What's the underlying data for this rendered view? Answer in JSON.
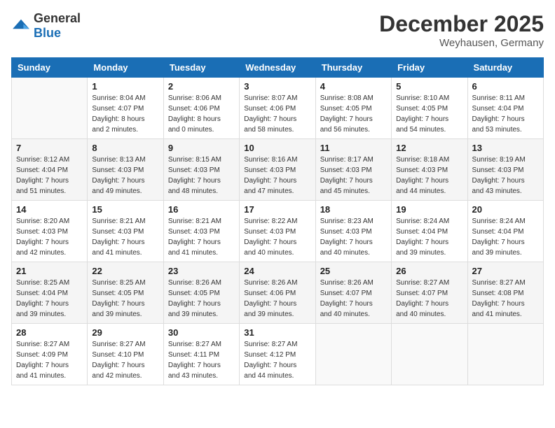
{
  "header": {
    "logo_general": "General",
    "logo_blue": "Blue",
    "title": "December 2025",
    "subtitle": "Weyhausen, Germany"
  },
  "calendar": {
    "days_of_week": [
      "Sunday",
      "Monday",
      "Tuesday",
      "Wednesday",
      "Thursday",
      "Friday",
      "Saturday"
    ],
    "weeks": [
      [
        {
          "day": "",
          "info": ""
        },
        {
          "day": "1",
          "info": "Sunrise: 8:04 AM\nSunset: 4:07 PM\nDaylight: 8 hours\nand 2 minutes."
        },
        {
          "day": "2",
          "info": "Sunrise: 8:06 AM\nSunset: 4:06 PM\nDaylight: 8 hours\nand 0 minutes."
        },
        {
          "day": "3",
          "info": "Sunrise: 8:07 AM\nSunset: 4:06 PM\nDaylight: 7 hours\nand 58 minutes."
        },
        {
          "day": "4",
          "info": "Sunrise: 8:08 AM\nSunset: 4:05 PM\nDaylight: 7 hours\nand 56 minutes."
        },
        {
          "day": "5",
          "info": "Sunrise: 8:10 AM\nSunset: 4:05 PM\nDaylight: 7 hours\nand 54 minutes."
        },
        {
          "day": "6",
          "info": "Sunrise: 8:11 AM\nSunset: 4:04 PM\nDaylight: 7 hours\nand 53 minutes."
        }
      ],
      [
        {
          "day": "7",
          "info": "Sunrise: 8:12 AM\nSunset: 4:04 PM\nDaylight: 7 hours\nand 51 minutes."
        },
        {
          "day": "8",
          "info": "Sunrise: 8:13 AM\nSunset: 4:03 PM\nDaylight: 7 hours\nand 49 minutes."
        },
        {
          "day": "9",
          "info": "Sunrise: 8:15 AM\nSunset: 4:03 PM\nDaylight: 7 hours\nand 48 minutes."
        },
        {
          "day": "10",
          "info": "Sunrise: 8:16 AM\nSunset: 4:03 PM\nDaylight: 7 hours\nand 47 minutes."
        },
        {
          "day": "11",
          "info": "Sunrise: 8:17 AM\nSunset: 4:03 PM\nDaylight: 7 hours\nand 45 minutes."
        },
        {
          "day": "12",
          "info": "Sunrise: 8:18 AM\nSunset: 4:03 PM\nDaylight: 7 hours\nand 44 minutes."
        },
        {
          "day": "13",
          "info": "Sunrise: 8:19 AM\nSunset: 4:03 PM\nDaylight: 7 hours\nand 43 minutes."
        }
      ],
      [
        {
          "day": "14",
          "info": "Sunrise: 8:20 AM\nSunset: 4:03 PM\nDaylight: 7 hours\nand 42 minutes."
        },
        {
          "day": "15",
          "info": "Sunrise: 8:21 AM\nSunset: 4:03 PM\nDaylight: 7 hours\nand 41 minutes."
        },
        {
          "day": "16",
          "info": "Sunrise: 8:21 AM\nSunset: 4:03 PM\nDaylight: 7 hours\nand 41 minutes."
        },
        {
          "day": "17",
          "info": "Sunrise: 8:22 AM\nSunset: 4:03 PM\nDaylight: 7 hours\nand 40 minutes."
        },
        {
          "day": "18",
          "info": "Sunrise: 8:23 AM\nSunset: 4:03 PM\nDaylight: 7 hours\nand 40 minutes."
        },
        {
          "day": "19",
          "info": "Sunrise: 8:24 AM\nSunset: 4:04 PM\nDaylight: 7 hours\nand 39 minutes."
        },
        {
          "day": "20",
          "info": "Sunrise: 8:24 AM\nSunset: 4:04 PM\nDaylight: 7 hours\nand 39 minutes."
        }
      ],
      [
        {
          "day": "21",
          "info": "Sunrise: 8:25 AM\nSunset: 4:04 PM\nDaylight: 7 hours\nand 39 minutes."
        },
        {
          "day": "22",
          "info": "Sunrise: 8:25 AM\nSunset: 4:05 PM\nDaylight: 7 hours\nand 39 minutes."
        },
        {
          "day": "23",
          "info": "Sunrise: 8:26 AM\nSunset: 4:05 PM\nDaylight: 7 hours\nand 39 minutes."
        },
        {
          "day": "24",
          "info": "Sunrise: 8:26 AM\nSunset: 4:06 PM\nDaylight: 7 hours\nand 39 minutes."
        },
        {
          "day": "25",
          "info": "Sunrise: 8:26 AM\nSunset: 4:07 PM\nDaylight: 7 hours\nand 40 minutes."
        },
        {
          "day": "26",
          "info": "Sunrise: 8:27 AM\nSunset: 4:07 PM\nDaylight: 7 hours\nand 40 minutes."
        },
        {
          "day": "27",
          "info": "Sunrise: 8:27 AM\nSunset: 4:08 PM\nDaylight: 7 hours\nand 41 minutes."
        }
      ],
      [
        {
          "day": "28",
          "info": "Sunrise: 8:27 AM\nSunset: 4:09 PM\nDaylight: 7 hours\nand 41 minutes."
        },
        {
          "day": "29",
          "info": "Sunrise: 8:27 AM\nSunset: 4:10 PM\nDaylight: 7 hours\nand 42 minutes."
        },
        {
          "day": "30",
          "info": "Sunrise: 8:27 AM\nSunset: 4:11 PM\nDaylight: 7 hours\nand 43 minutes."
        },
        {
          "day": "31",
          "info": "Sunrise: 8:27 AM\nSunset: 4:12 PM\nDaylight: 7 hours\nand 44 minutes."
        },
        {
          "day": "",
          "info": ""
        },
        {
          "day": "",
          "info": ""
        },
        {
          "day": "",
          "info": ""
        }
      ]
    ]
  }
}
